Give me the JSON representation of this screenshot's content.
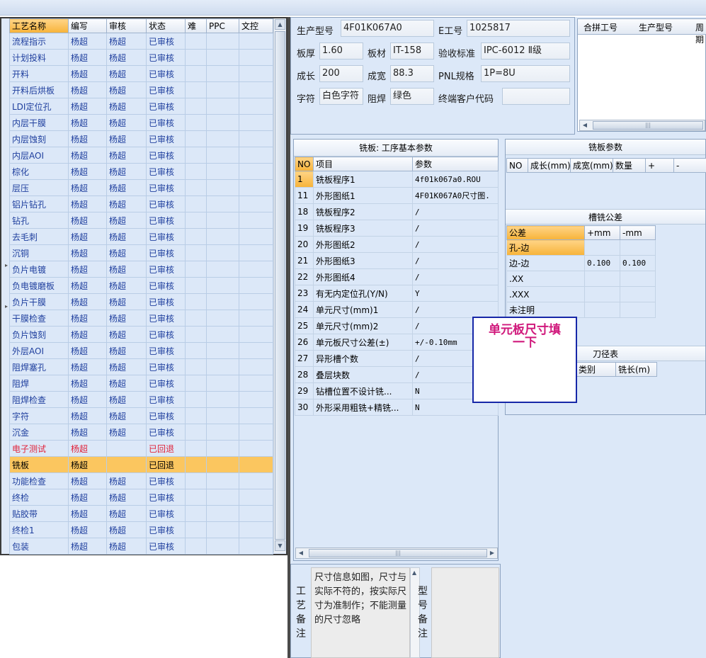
{
  "process_list": {
    "headers": [
      "工艺名称",
      "编写",
      "审核",
      "状态",
      "难",
      "PPC",
      "文控"
    ],
    "rows": [
      {
        "name": "流程指示",
        "writer": "杨超",
        "reviewer": "杨超",
        "status": "已审核"
      },
      {
        "name": "计划投料",
        "writer": "杨超",
        "reviewer": "杨超",
        "status": "已审核"
      },
      {
        "name": "开料",
        "writer": "杨超",
        "reviewer": "杨超",
        "status": "已审核"
      },
      {
        "name": "开料后烘板",
        "writer": "杨超",
        "reviewer": "杨超",
        "status": "已审核"
      },
      {
        "name": "LDI定位孔",
        "writer": "杨超",
        "reviewer": "杨超",
        "status": "已审核"
      },
      {
        "name": "内层干膜",
        "writer": "杨超",
        "reviewer": "杨超",
        "status": "已审核"
      },
      {
        "name": "内层蚀刻",
        "writer": "杨超",
        "reviewer": "杨超",
        "status": "已审核"
      },
      {
        "name": "内层AOI",
        "writer": "杨超",
        "reviewer": "杨超",
        "status": "已审核"
      },
      {
        "name": "棕化",
        "writer": "杨超",
        "reviewer": "杨超",
        "status": "已审核"
      },
      {
        "name": "层压",
        "writer": "杨超",
        "reviewer": "杨超",
        "status": "已审核"
      },
      {
        "name": "铝片钻孔",
        "writer": "杨超",
        "reviewer": "杨超",
        "status": "已审核"
      },
      {
        "name": "钻孔",
        "writer": "杨超",
        "reviewer": "杨超",
        "status": "已审核"
      },
      {
        "name": "去毛刺",
        "writer": "杨超",
        "reviewer": "杨超",
        "status": "已审核"
      },
      {
        "name": "沉铜",
        "writer": "杨超",
        "reviewer": "杨超",
        "status": "已审核"
      },
      {
        "name": "负片电镀",
        "writer": "杨超",
        "reviewer": "杨超",
        "status": "已审核"
      },
      {
        "name": "负电镀磨板",
        "writer": "杨超",
        "reviewer": "杨超",
        "status": "已审核"
      },
      {
        "name": "负片干膜",
        "writer": "杨超",
        "reviewer": "杨超",
        "status": "已审核"
      },
      {
        "name": "干膜检查",
        "writer": "杨超",
        "reviewer": "杨超",
        "status": "已审核"
      },
      {
        "name": "负片蚀刻",
        "writer": "杨超",
        "reviewer": "杨超",
        "status": "已审核"
      },
      {
        "name": "外层AOI",
        "writer": "杨超",
        "reviewer": "杨超",
        "status": "已审核"
      },
      {
        "name": "阻焊塞孔",
        "writer": "杨超",
        "reviewer": "杨超",
        "status": "已审核"
      },
      {
        "name": "阻焊",
        "writer": "杨超",
        "reviewer": "杨超",
        "status": "已审核"
      },
      {
        "name": "阻焊检查",
        "writer": "杨超",
        "reviewer": "杨超",
        "status": "已审核"
      },
      {
        "name": "字符",
        "writer": "杨超",
        "reviewer": "杨超",
        "status": "已审核"
      },
      {
        "name": "沉金",
        "writer": "杨超",
        "reviewer": "杨超",
        "status": "已审核"
      },
      {
        "name": "电子测试",
        "writer": "杨超",
        "reviewer": "",
        "status": "已回退",
        "style": "red"
      },
      {
        "name": "铣板",
        "writer": "杨超",
        "reviewer": "",
        "status": "已回退",
        "style": "cur"
      },
      {
        "name": "功能检查",
        "writer": "杨超",
        "reviewer": "杨超",
        "status": "已审核"
      },
      {
        "name": "终检",
        "writer": "杨超",
        "reviewer": "杨超",
        "status": "已审核"
      },
      {
        "name": "贴胶带",
        "writer": "杨超",
        "reviewer": "杨超",
        "status": "已审核"
      },
      {
        "name": "终检1",
        "writer": "杨超",
        "reviewer": "杨超",
        "status": "已审核"
      },
      {
        "name": "包装",
        "writer": "杨超",
        "reviewer": "杨超",
        "status": "已审核"
      }
    ]
  },
  "info": {
    "model_label": "生产型号",
    "model_value": "4F01K067A0",
    "job_label": "E工号",
    "job_value": "1025817",
    "thickness_label": "板厚",
    "thickness_value": "1.60",
    "material_label": "板材",
    "material_value": "IT-158",
    "standard_label": "验收标准",
    "standard_value": "IPC-6012 Ⅱ级",
    "length_label": "成长",
    "length_value": "200",
    "width_label": "成宽",
    "width_value": "88.3",
    "pnl_label": "PNL规格",
    "pnl_value": "1P=8U",
    "char_label": "字符",
    "char_value": "白色字符",
    "mask_label": "阻焊",
    "mask_value": "绿色",
    "customer_label": "终端客户代码",
    "customer_value": ""
  },
  "combine": {
    "headers": [
      "合拼工号",
      "生产型号",
      "周期"
    ]
  },
  "mill": {
    "title": "铣板: 工序基本参数",
    "headers": [
      "NO",
      "项目",
      "参数"
    ],
    "rows": [
      {
        "no": "1",
        "item": "铣板程序1",
        "param": "4f01k067a0.ROU",
        "sel": true
      },
      {
        "no": "11",
        "item": "外形图纸1",
        "param": "4F01K067A0尺寸图."
      },
      {
        "no": "18",
        "item": "铣板程序2",
        "param": "/"
      },
      {
        "no": "19",
        "item": "铣板程序3",
        "param": "/"
      },
      {
        "no": "20",
        "item": "外形图纸2",
        "param": "/"
      },
      {
        "no": "21",
        "item": "外形图纸3",
        "param": "/"
      },
      {
        "no": "22",
        "item": "外形图纸4",
        "param": "/"
      },
      {
        "no": "23",
        "item": "有无内定位孔(Y/N)",
        "param": "Y"
      },
      {
        "no": "24",
        "item": "单元尺寸(mm)1",
        "param": "/"
      },
      {
        "no": "25",
        "item": "单元尺寸(mm)2",
        "param": "/"
      },
      {
        "no": "26",
        "item": "单元板尺寸公差(±)",
        "param": "+/-0.10mm"
      },
      {
        "no": "27",
        "item": "异形槽个数",
        "param": "/"
      },
      {
        "no": "28",
        "item": "叠层块数",
        "param": "/"
      },
      {
        "no": "29",
        "item": "钻槽位置不设计铣...",
        "param": "N"
      },
      {
        "no": "30",
        "item": "外形采用粗铣+精铣...",
        "param": "N"
      }
    ]
  },
  "params": {
    "title": "铣板参数",
    "headers": [
      "NO",
      "成长(mm)",
      "成宽(mm)",
      "数量",
      "+",
      "-"
    ]
  },
  "tolerance": {
    "title": "槽铣公差",
    "headers": [
      "公差",
      "+mm",
      "-mm"
    ],
    "rows": [
      {
        "name": "孔-边",
        "plus": "",
        "minus": "",
        "sel": true
      },
      {
        "name": "边-边",
        "plus": "0.100",
        "minus": "0.100"
      },
      {
        "name": ".XX",
        "plus": "",
        "minus": ""
      },
      {
        "name": ".XXX",
        "plus": "",
        "minus": ""
      },
      {
        "name": "未注明",
        "plus": "",
        "minus": ""
      }
    ]
  },
  "tools": {
    "title": "刀径表",
    "headers": [
      "类别",
      "铣长(m)"
    ]
  },
  "callout": {
    "line1": "单元板尺寸填",
    "line2": "一下"
  },
  "remark": {
    "process_label": [
      "工",
      "艺",
      "备",
      "注"
    ],
    "process_text": "尺寸信息如图，尺寸与实际不符的，按实际尺寸为准制作；不能测量的尺寸忽略",
    "model_label": [
      "型",
      "号",
      "备",
      "注"
    ]
  }
}
